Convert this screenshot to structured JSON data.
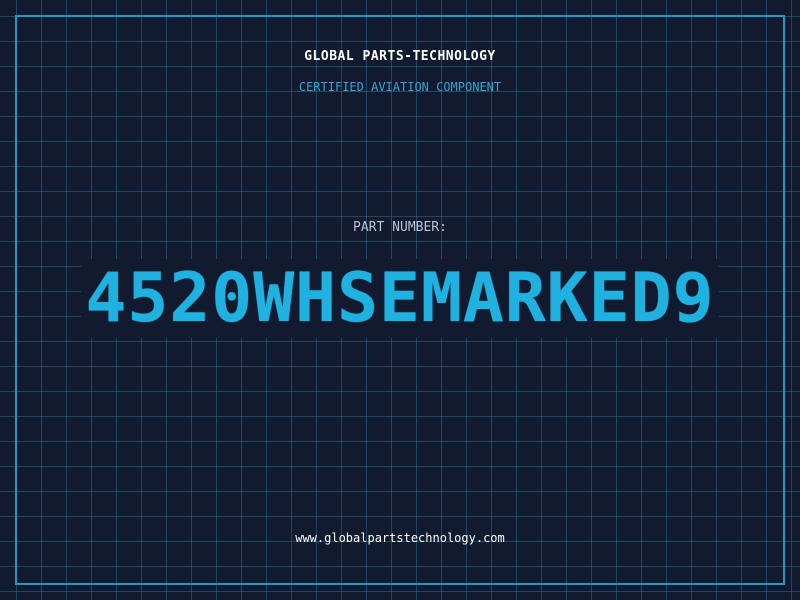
{
  "header": {
    "company": "GLOBAL PARTS-TECHNOLOGY",
    "tagline": "CERTIFIED AVIATION COMPONENT"
  },
  "part": {
    "label": "PART NUMBER:",
    "number": "4520WHSEMARKED9"
  },
  "footer": {
    "website": "www.globalpartstechnology.com"
  },
  "colors": {
    "background": "#111a2e",
    "grid": "#286e8c",
    "frame": "#1f9ac2",
    "accent": "#1fb1df"
  }
}
